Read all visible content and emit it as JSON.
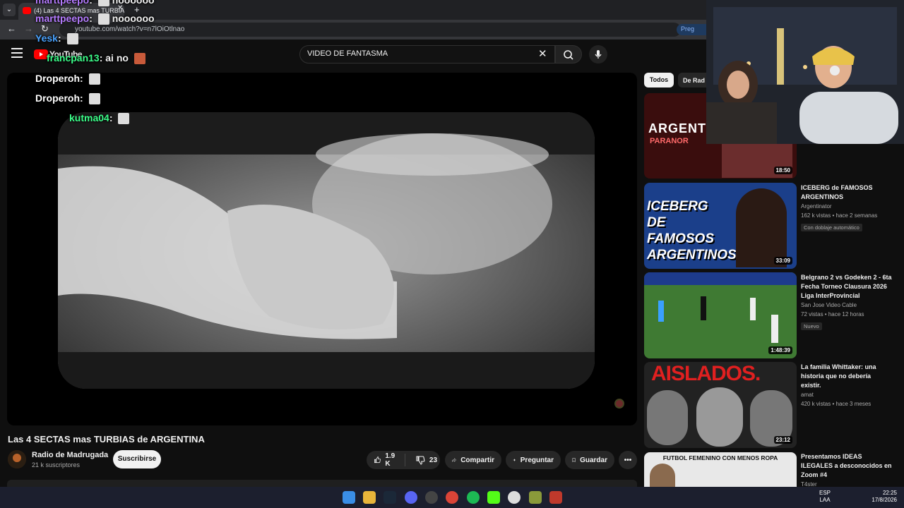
{
  "browser": {
    "tab_title": "(4) Las 4 SECTAS mas TURBIAS",
    "new_tab": "+",
    "url": "youtube.com/watch?v=n7lOiOtlnao",
    "translate_label": "Preg"
  },
  "youtube": {
    "logo_text": "YouTube",
    "search_query": "VIDEO DE FANTASMA"
  },
  "video": {
    "title": "Las 4 SECTAS mas TURBIAS de ARGENTINA",
    "channel": "Radio de Madrugada",
    "subscribers": "21 k suscriptores",
    "subscribe_label": "Suscribirse",
    "likes": "1.9 K",
    "dislikes": "23",
    "share_label": "Compartir",
    "ask_label": "Preguntar",
    "save_label": "Guardar"
  },
  "chips": {
    "all": "Todos",
    "second": "De Rad"
  },
  "recommendations": [
    {
      "thumb_text": "ARGENTI",
      "thumb_sub": "PARANOR",
      "duration": "18:50",
      "title": "",
      "channel": "",
      "meta": "",
      "badge": ""
    },
    {
      "thumb_text": "ICEBERG DE FAMOSOS ARGENTINOS",
      "duration": "33:09",
      "title": "ICEBERG de FAMOSOS ARGENTINOS",
      "channel": "Argentinator",
      "meta": "162 k vistas • hace 2 semanas",
      "badge": "Con doblaje automático"
    },
    {
      "thumb_text": "",
      "duration": "1:48:39",
      "title": "Belgrano 2 vs Godeken 2 - 6ta Fecha Torneo Clausura 2026 Liga InterProvincial",
      "channel": "San Jose Video Cable",
      "meta": "72 vistas • hace 12 horas",
      "badge": "Nuevo"
    },
    {
      "thumb_text": "AISLADOS.",
      "duration": "23:12",
      "title": "La familia Whittaker: una historia que no debería existir.",
      "channel": "amat",
      "meta": "420 k vistas • hace 3 meses",
      "badge": ""
    },
    {
      "thumb_text": "FUTBOL FEMENINO CON MENOS ROPA",
      "duration": "",
      "title": "Presentamos IDEAS ILEGALES a desconocidos en Zoom #4",
      "channel": "T4ster",
      "meta": "",
      "badge": ""
    }
  ],
  "chat": [
    {
      "user": "marttpeepo",
      "color": "#b57bff",
      "text": "noooooo"
    },
    {
      "user": "marttpeepo",
      "color": "#b57bff",
      "text": "noooooo"
    },
    {
      "user": "Yesk",
      "color": "#4aa3ff",
      "text": ""
    },
    {
      "user": "francpan13",
      "color": "#3cff8a",
      "text": "ai no"
    },
    {
      "user": "Droperoh",
      "color": "#ffffff",
      "text": ""
    },
    {
      "user": "Droperoh",
      "color": "#ffffff",
      "text": ""
    },
    {
      "user": "kutma04",
      "color": "#3cff8a",
      "text": ""
    }
  ],
  "taskbar": {
    "lang_1": "ESP",
    "lang_2": "LAA",
    "time": "22:25",
    "date": "17/8/2026"
  },
  "colors": {
    "background": "#0f0f0f",
    "brand_red": "#ff0000",
    "chip_active": "#f1f1f1"
  },
  "icons": [
    "menu-icon",
    "youtube-logo-icon",
    "close-icon",
    "search-icon",
    "mic-icon",
    "like-icon",
    "dislike-icon",
    "share-icon",
    "sparkle-icon",
    "bookmark-icon",
    "more-icon"
  ]
}
